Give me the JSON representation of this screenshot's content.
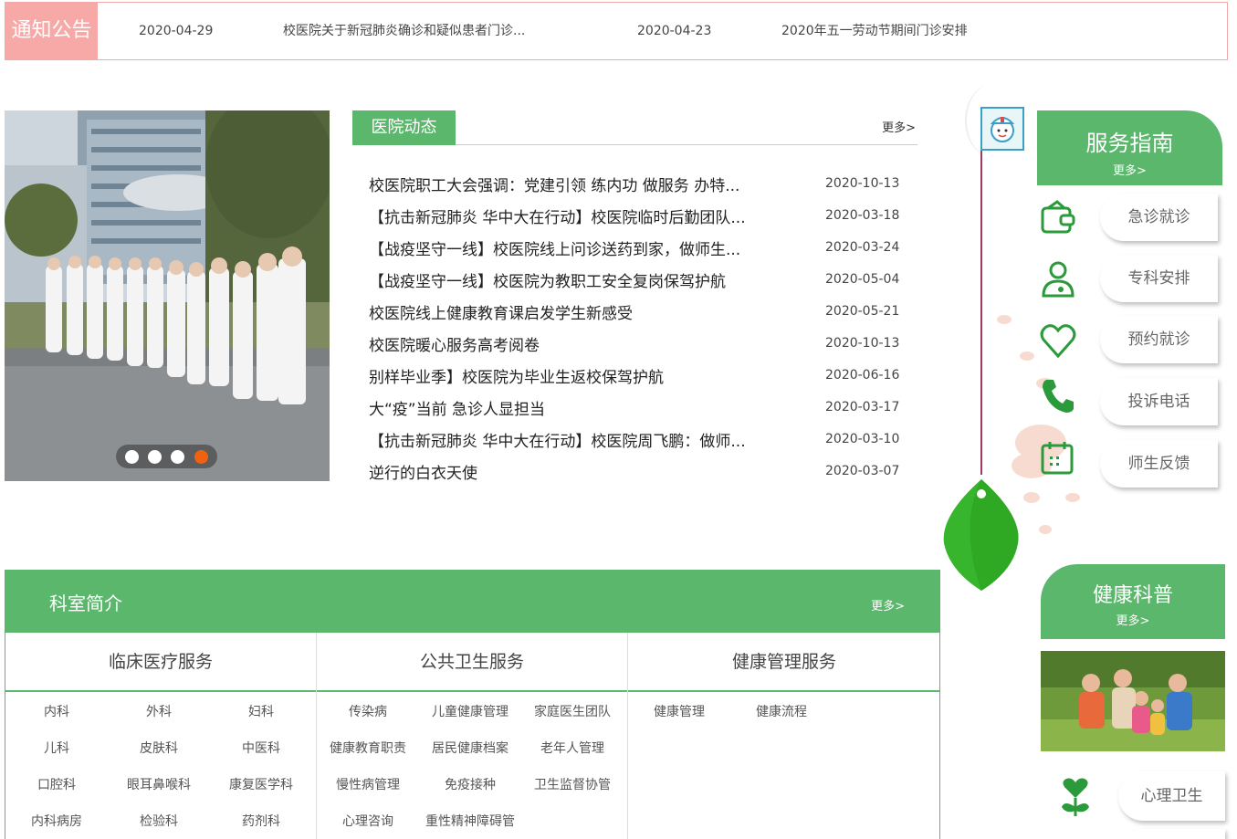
{
  "notice": {
    "label": "通知公告",
    "items": [
      {
        "date": "2020-04-29",
        "title": "校医院关于新冠肺炎确诊和疑似患者门诊..."
      },
      {
        "date": "2020-04-23",
        "title": "2020年五一劳动节期间门诊安排"
      }
    ]
  },
  "slider": {
    "dot_count": 4,
    "active_index": 3
  },
  "news": {
    "title": "医院动态",
    "more": "更多>",
    "items": [
      {
        "title": "校医院职工大会强调：党建引领 练内功 做服务 办特...",
        "date": "2020-10-13"
      },
      {
        "title": "【抗击新冠肺炎 华中大在行动】校医院临时后勤团队...",
        "date": "2020-03-18"
      },
      {
        "title": "【战疫坚守一线】校医院线上问诊送药到家，做师生...",
        "date": "2020-03-24"
      },
      {
        "title": "【战疫坚守一线】校医院为教职工安全复岗保驾护航",
        "date": "2020-05-04"
      },
      {
        "title": "校医院线上健康教育课启发学生新感受",
        "date": "2020-05-21"
      },
      {
        "title": "校医院暖心服务高考阅卷",
        "date": "2020-10-13"
      },
      {
        "title": "别样毕业季】校医院为毕业生返校保驾护航",
        "date": "2020-06-16"
      },
      {
        "title": "大“疫”当前 急诊人显担当",
        "date": "2020-03-17"
      },
      {
        "title": "【抗击新冠肺炎 华中大在行动】校医院周飞鹏：做师...",
        "date": "2020-03-10"
      },
      {
        "title": "逆行的白衣天使",
        "date": "2020-03-07"
      }
    ]
  },
  "service": {
    "title": "服务指南",
    "more": "更多>",
    "items": [
      {
        "label": "急诊就诊",
        "icon": "wallet-icon"
      },
      {
        "label": "专科安排",
        "icon": "doctor-icon"
      },
      {
        "label": "预约就诊",
        "icon": "heart-icon"
      },
      {
        "label": "投诉电话",
        "icon": "phone-icon"
      },
      {
        "label": "师生反馈",
        "icon": "calendar-icon"
      }
    ]
  },
  "dept": {
    "title": "科室简介",
    "more": "更多>",
    "columns": [
      {
        "title": "临床医疗服务",
        "items": [
          "内科",
          "外科",
          "妇科",
          "儿科",
          "皮肤科",
          "中医科",
          "口腔科",
          "眼耳鼻喉科",
          "康复医学科",
          "内科病房",
          "检验科",
          "药剂科"
        ]
      },
      {
        "title": "公共卫生服务",
        "items": [
          "传染病",
          "儿童健康管理",
          "家庭医生团队",
          "健康教育职责",
          "居民健康档案",
          "老年人管理",
          "慢性病管理",
          "免疫接种",
          "卫生监督协管",
          "心理咨询",
          "重性精神障碍管"
        ]
      },
      {
        "title": "健康管理服务",
        "items": [
          "健康管理",
          "健康流程"
        ]
      }
    ]
  },
  "health": {
    "title": "健康科普",
    "more": "更多>",
    "button": "心理卫生",
    "icon": "plant-heart-icon"
  },
  "colors": {
    "green": "#5ab76b",
    "notice_pink": "#f7a9a8",
    "dot_active": "#f0620f"
  }
}
